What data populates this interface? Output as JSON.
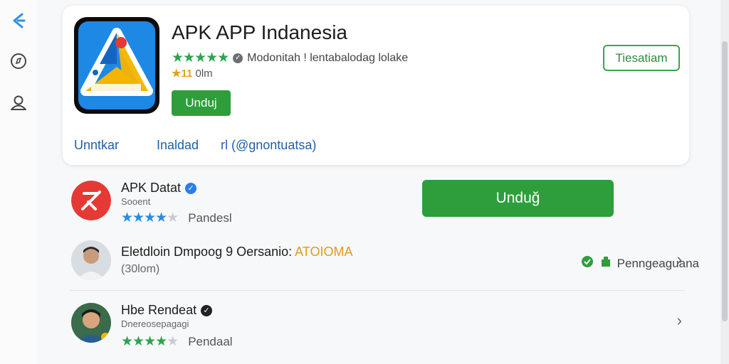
{
  "sidebar": {
    "icons": [
      "back-arrow-icon",
      "compass-icon",
      "profile-icon"
    ]
  },
  "hero": {
    "title": "APK APP Indanesia",
    "stars": "★★★★★",
    "developer": "Modonitah ! lentabalodag lolake",
    "meta_highlight": "★11",
    "meta_rest": " 0lm",
    "install_label": "Unduj",
    "outline_label": "Tiesatiam",
    "tabs": [
      "Unntkar",
      "Inaldad",
      "rl (@gnontuatsa)"
    ]
  },
  "list": [
    {
      "name": "APK Datat",
      "subtitle": "Sooent",
      "stars_on": "★★★★",
      "stars_off": "★",
      "label": "Pandesl",
      "install_label": "Unduğ"
    },
    {
      "name": "Eletdloin Dmpoog 9 Oersanio:",
      "name_highlight": "ATOIOMA",
      "subtitle": "(30lom)",
      "permission_label": "Penngeaguana"
    },
    {
      "name": "Hbe Rendeat",
      "subtitle": "Dnereosepagagi",
      "stars_on": "★★★★",
      "stars_off": "★",
      "label": "Pendaal"
    }
  ],
  "colors": {
    "accent_green": "#2e9e3c",
    "link_blue": "#1f5fa8",
    "star_blue": "#2b8be3",
    "highlight_orange": "#e39a16"
  }
}
